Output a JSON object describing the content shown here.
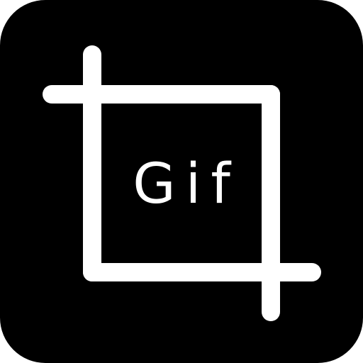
{
  "icon": {
    "label": "Gif",
    "symbol": "crop-icon",
    "background_color": "#000000",
    "foreground_color": "#ffffff"
  }
}
